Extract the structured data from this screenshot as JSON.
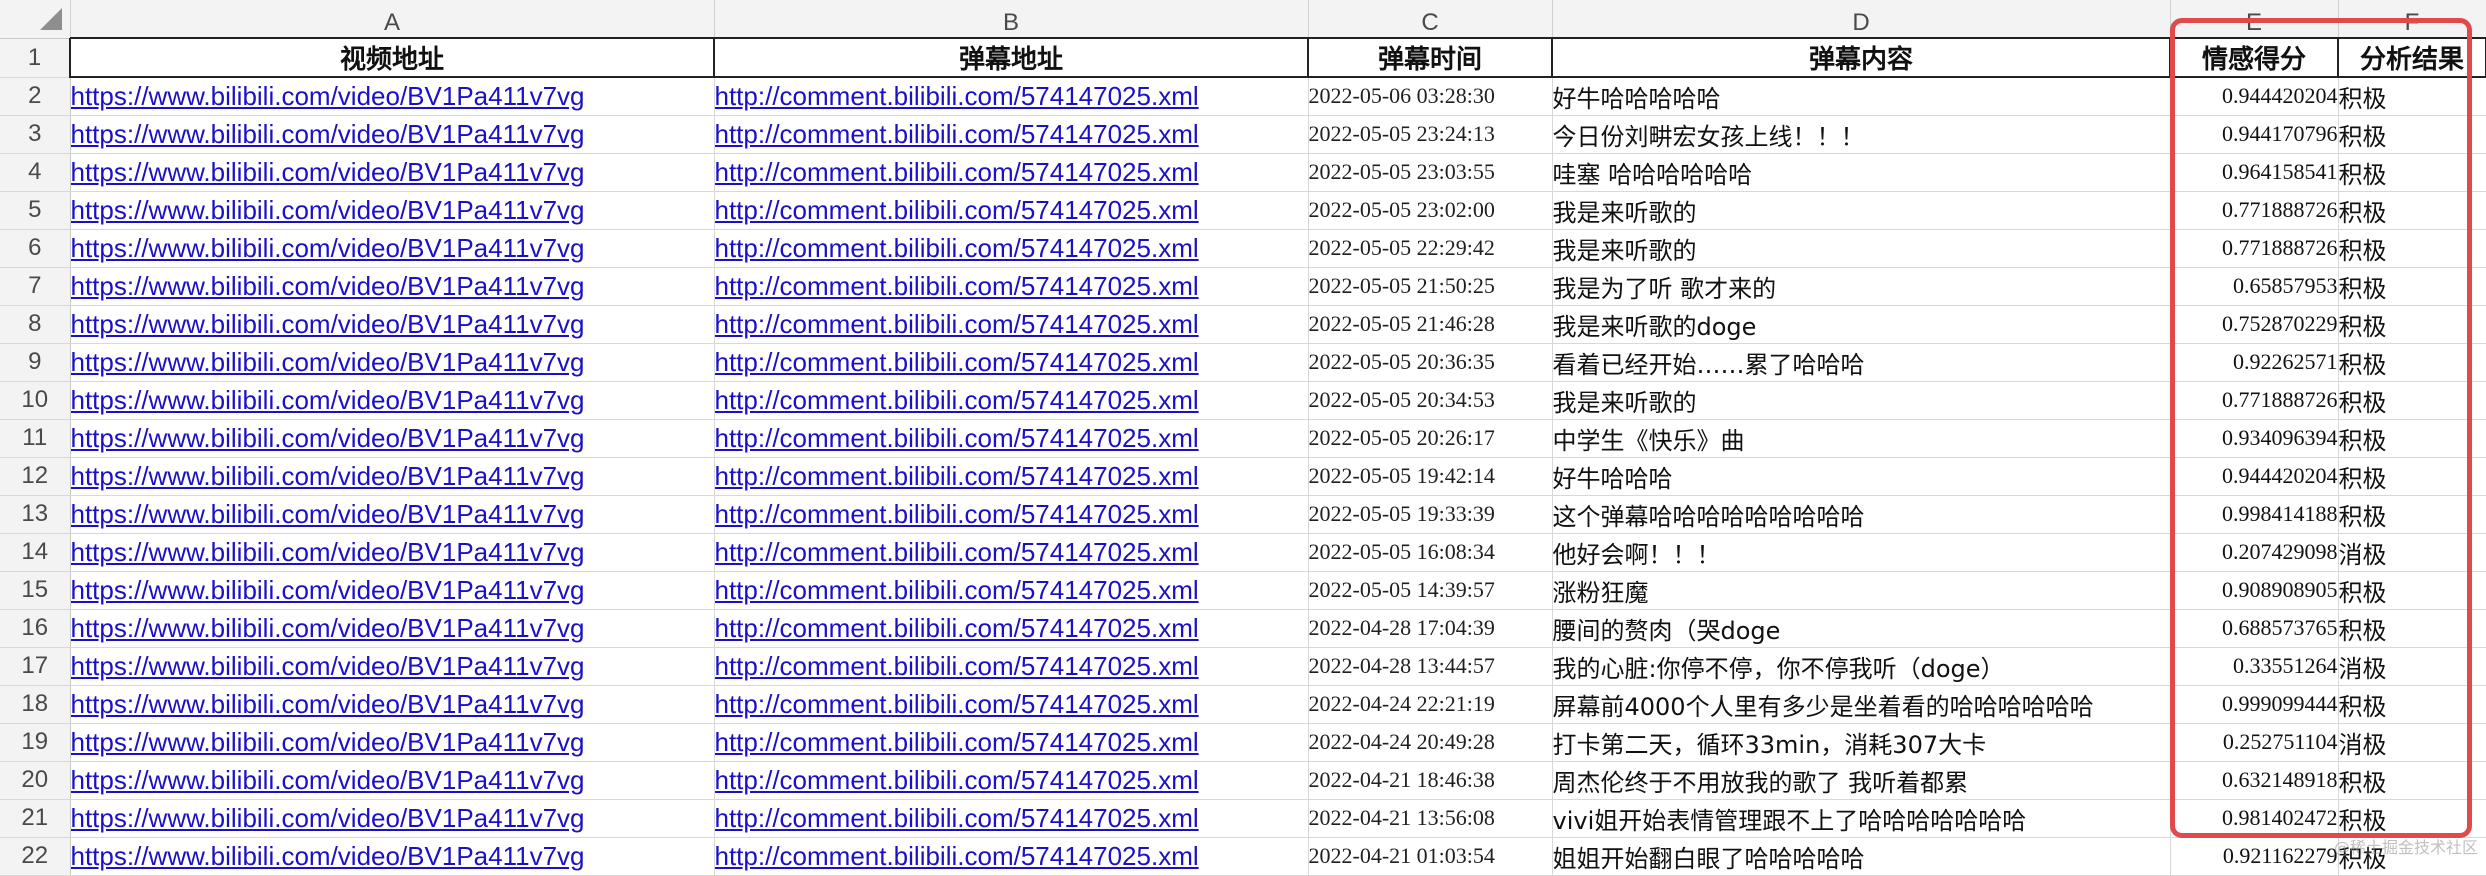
{
  "columns": [
    "A",
    "B",
    "C",
    "D",
    "E",
    "F"
  ],
  "header_row_number": "1",
  "headers": [
    "视频地址",
    "弹幕地址",
    "弹幕时间",
    "弹幕内容",
    "情感得分",
    "分析结果"
  ],
  "rows": [
    {
      "n": "2",
      "video": "https://www.bilibili.com/video/BV1Pa411v7vg",
      "danmaku_url": "http://comment.bilibili.com/574147025.xml",
      "time": "2022-05-06 03:28:30",
      "content": "好牛哈哈哈哈哈",
      "score": "0.944420204",
      "result": "积极"
    },
    {
      "n": "3",
      "video": "https://www.bilibili.com/video/BV1Pa411v7vg",
      "danmaku_url": "http://comment.bilibili.com/574147025.xml",
      "time": "2022-05-05 23:24:13",
      "content": "今日份刘畊宏女孩上线！！！",
      "score": "0.944170796",
      "result": "积极"
    },
    {
      "n": "4",
      "video": "https://www.bilibili.com/video/BV1Pa411v7vg",
      "danmaku_url": "http://comment.bilibili.com/574147025.xml",
      "time": "2022-05-05 23:03:55",
      "content": "哇塞 哈哈哈哈哈哈",
      "score": "0.964158541",
      "result": "积极"
    },
    {
      "n": "5",
      "video": "https://www.bilibili.com/video/BV1Pa411v7vg",
      "danmaku_url": "http://comment.bilibili.com/574147025.xml",
      "time": "2022-05-05 23:02:00",
      "content": "我是来听歌的",
      "score": "0.771888726",
      "result": "积极"
    },
    {
      "n": "6",
      "video": "https://www.bilibili.com/video/BV1Pa411v7vg",
      "danmaku_url": "http://comment.bilibili.com/574147025.xml",
      "time": "2022-05-05 22:29:42",
      "content": "我是来听歌的",
      "score": "0.771888726",
      "result": "积极"
    },
    {
      "n": "7",
      "video": "https://www.bilibili.com/video/BV1Pa411v7vg",
      "danmaku_url": "http://comment.bilibili.com/574147025.xml",
      "time": "2022-05-05 21:50:25",
      "content": "我是为了听 歌才来的",
      "score": "0.65857953",
      "result": "积极"
    },
    {
      "n": "8",
      "video": "https://www.bilibili.com/video/BV1Pa411v7vg",
      "danmaku_url": "http://comment.bilibili.com/574147025.xml",
      "time": "2022-05-05 21:46:28",
      "content": "我是来听歌的doge",
      "score": "0.752870229",
      "result": "积极"
    },
    {
      "n": "9",
      "video": "https://www.bilibili.com/video/BV1Pa411v7vg",
      "danmaku_url": "http://comment.bilibili.com/574147025.xml",
      "time": "2022-05-05 20:36:35",
      "content": "看着已经开始……累了哈哈哈",
      "score": "0.92262571",
      "result": "积极"
    },
    {
      "n": "10",
      "video": "https://www.bilibili.com/video/BV1Pa411v7vg",
      "danmaku_url": "http://comment.bilibili.com/574147025.xml",
      "time": "2022-05-05 20:34:53",
      "content": "我是来听歌的",
      "score": "0.771888726",
      "result": "积极"
    },
    {
      "n": "11",
      "video": "https://www.bilibili.com/video/BV1Pa411v7vg",
      "danmaku_url": "http://comment.bilibili.com/574147025.xml",
      "time": "2022-05-05 20:26:17",
      "content": "中学生《快乐》曲",
      "score": "0.934096394",
      "result": "积极"
    },
    {
      "n": "12",
      "video": "https://www.bilibili.com/video/BV1Pa411v7vg",
      "danmaku_url": "http://comment.bilibili.com/574147025.xml",
      "time": "2022-05-05 19:42:14",
      "content": "好牛哈哈哈",
      "score": "0.944420204",
      "result": "积极"
    },
    {
      "n": "13",
      "video": "https://www.bilibili.com/video/BV1Pa411v7vg",
      "danmaku_url": "http://comment.bilibili.com/574147025.xml",
      "time": "2022-05-05 19:33:39",
      "content": "这个弹幕哈哈哈哈哈哈哈哈哈",
      "score": "0.998414188",
      "result": "积极"
    },
    {
      "n": "14",
      "video": "https://www.bilibili.com/video/BV1Pa411v7vg",
      "danmaku_url": "http://comment.bilibili.com/574147025.xml",
      "time": "2022-05-05 16:08:34",
      "content": "他好会啊！！！",
      "score": "0.207429098",
      "result": "消极"
    },
    {
      "n": "15",
      "video": "https://www.bilibili.com/video/BV1Pa411v7vg",
      "danmaku_url": "http://comment.bilibili.com/574147025.xml",
      "time": "2022-05-05 14:39:57",
      "content": "涨粉狂魔",
      "score": "0.908908905",
      "result": "积极"
    },
    {
      "n": "16",
      "video": "https://www.bilibili.com/video/BV1Pa411v7vg",
      "danmaku_url": "http://comment.bilibili.com/574147025.xml",
      "time": "2022-04-28 17:04:39",
      "content": "腰间的赘肉（哭doge",
      "score": "0.688573765",
      "result": "积极"
    },
    {
      "n": "17",
      "video": "https://www.bilibili.com/video/BV1Pa411v7vg",
      "danmaku_url": "http://comment.bilibili.com/574147025.xml",
      "time": "2022-04-28 13:44:57",
      "content": "我的心脏:你停不停，你不停我听（doge）",
      "score": "0.33551264",
      "result": "消极"
    },
    {
      "n": "18",
      "video": "https://www.bilibili.com/video/BV1Pa411v7vg",
      "danmaku_url": "http://comment.bilibili.com/574147025.xml",
      "time": "2022-04-24 22:21:19",
      "content": "屏幕前4000个人里有多少是坐着看的哈哈哈哈哈哈",
      "score": "0.999099444",
      "result": "积极"
    },
    {
      "n": "19",
      "video": "https://www.bilibili.com/video/BV1Pa411v7vg",
      "danmaku_url": "http://comment.bilibili.com/574147025.xml",
      "time": "2022-04-24 20:49:28",
      "content": "打卡第二天，循环33min，消耗307大卡",
      "score": "0.252751104",
      "result": "消极"
    },
    {
      "n": "20",
      "video": "https://www.bilibili.com/video/BV1Pa411v7vg",
      "danmaku_url": "http://comment.bilibili.com/574147025.xml",
      "time": "2022-04-21 18:46:38",
      "content": "周杰伦终于不用放我的歌了 我听着都累",
      "score": "0.632148918",
      "result": "积极"
    },
    {
      "n": "21",
      "video": "https://www.bilibili.com/video/BV1Pa411v7vg",
      "danmaku_url": "http://comment.bilibili.com/574147025.xml",
      "time": "2022-04-21 13:56:08",
      "content": "vivi姐开始表情管理跟不上了哈哈哈哈哈哈哈",
      "score": "0.981402472",
      "result": "积极"
    },
    {
      "n": "22",
      "video": "https://www.bilibili.com/video/BV1Pa411v7vg",
      "danmaku_url": "http://comment.bilibili.com/574147025.xml",
      "time": "2022-04-21 01:03:54",
      "content": "姐姐开始翻白眼了哈哈哈哈哈",
      "score": "0.921162279",
      "result": "积极"
    }
  ],
  "watermark": "@稀土掘金技术社区"
}
